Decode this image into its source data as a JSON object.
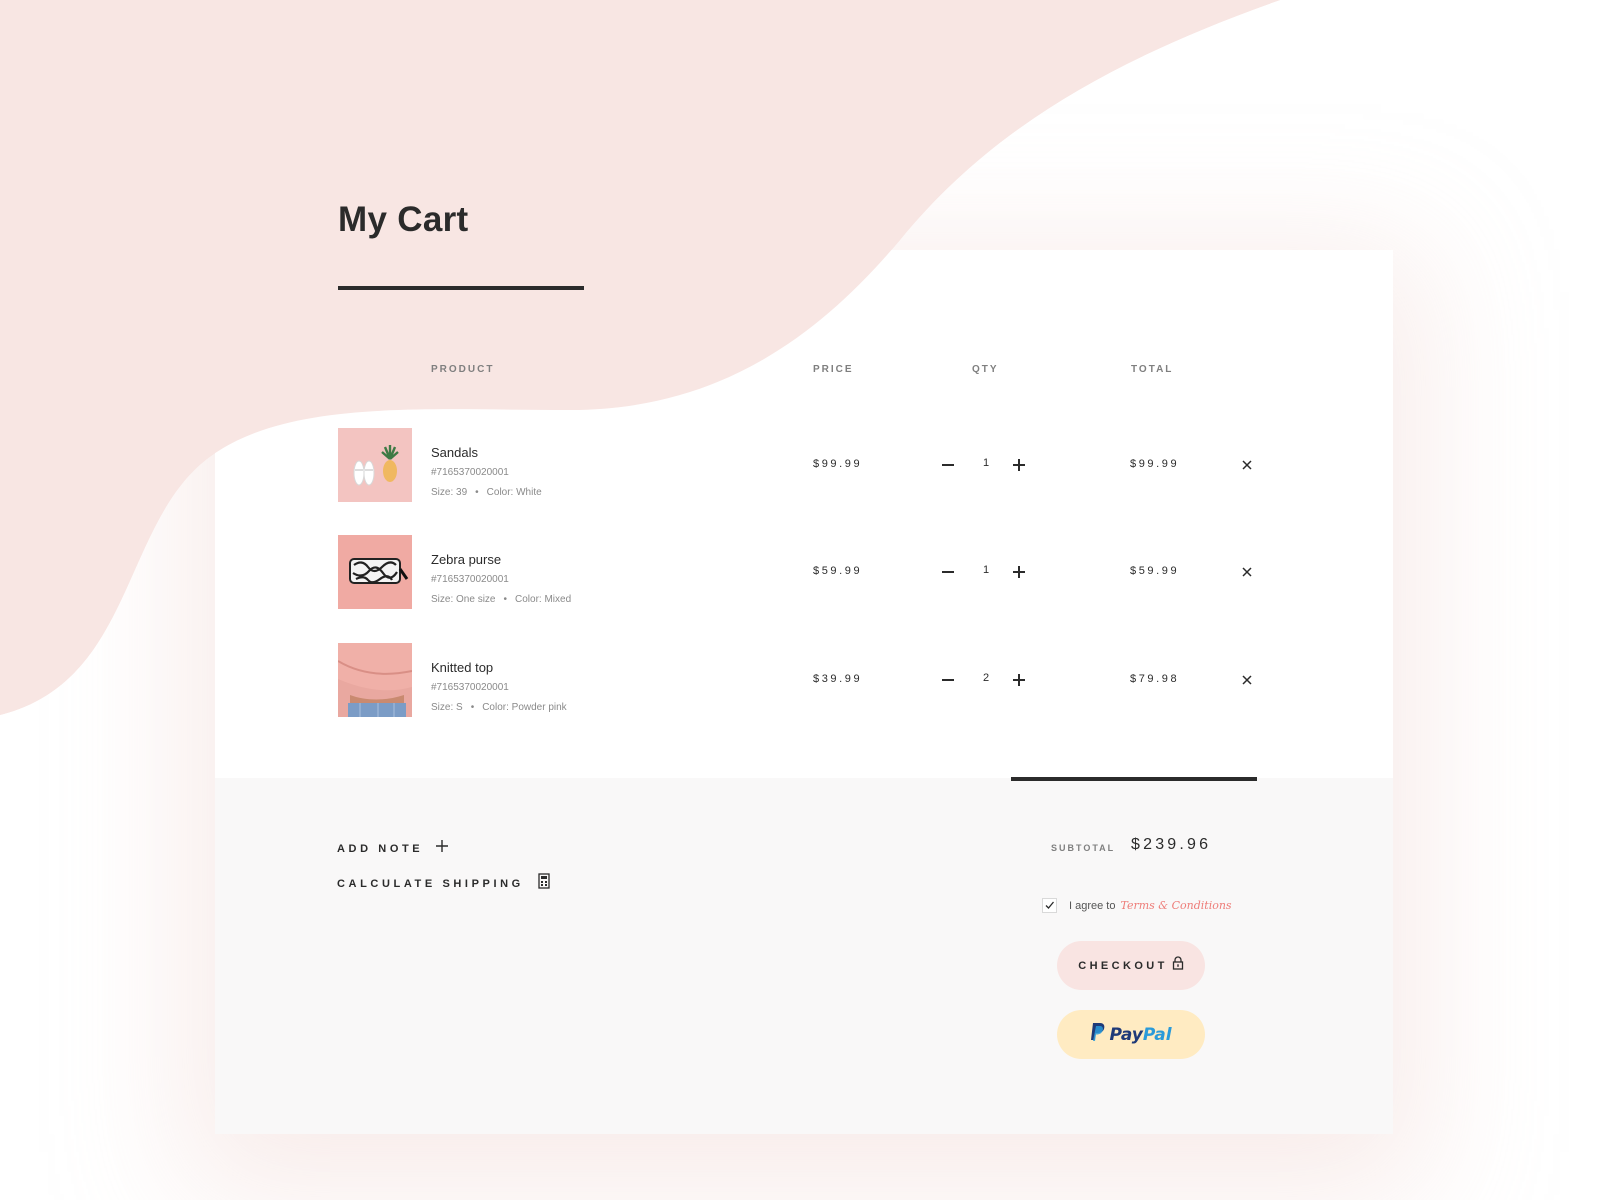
{
  "page": {
    "title": "My Cart"
  },
  "table": {
    "headers": {
      "product": "PRODUCT",
      "price": "PRICE",
      "qty": "QTY",
      "total": "TOTAL"
    }
  },
  "items": [
    {
      "name": "Sandals",
      "sku": "#7165370020001",
      "size": "Size: 39",
      "color": "Color: White",
      "price": "$99.99",
      "qty": "1",
      "total": "$99.99",
      "image": "sandals-and-pineapple-photo"
    },
    {
      "name": "Zebra purse",
      "sku": "#7165370020001",
      "size": "Size: One size",
      "color": "Color: Mixed",
      "price": "$59.99",
      "qty": "1",
      "total": "$59.99",
      "image": "zebra-purse-photo"
    },
    {
      "name": "Knitted top",
      "sku": "#7165370020001",
      "size": "Size: S",
      "color": "Color: Powder pink",
      "price": "$39.99",
      "qty": "2",
      "total": "$79.98",
      "image": "knitted-top-photo"
    }
  ],
  "summary": {
    "add_note": "ADD NOTE",
    "calculate_shipping": "CALCULATE SHIPPING",
    "subtotal_label": "SUBTOTAL",
    "subtotal_value": "$239.96",
    "agree_text": "I agree to",
    "terms_link": "Terms & Conditions",
    "agree_checked": true,
    "checkout_label": "CHECKOUT",
    "paypal_part1": "Pay",
    "paypal_part2": "Pal"
  },
  "icons": {
    "add_note": "plus-icon",
    "calculate_shipping": "calculator-icon",
    "checkout": "lock-icon",
    "remove": "close-icon",
    "paypal": "paypal-logo-icon"
  },
  "colors": {
    "accent_blob": "#f8e6e3",
    "text_dark": "#2b2b2b",
    "terms_link": "#ee7d79",
    "checkout_bg": "#f9e4e2",
    "paypal_bg": "#ffebc2",
    "paypal_dark_blue": "#1f3a78",
    "paypal_light_blue": "#2a9ad9"
  }
}
